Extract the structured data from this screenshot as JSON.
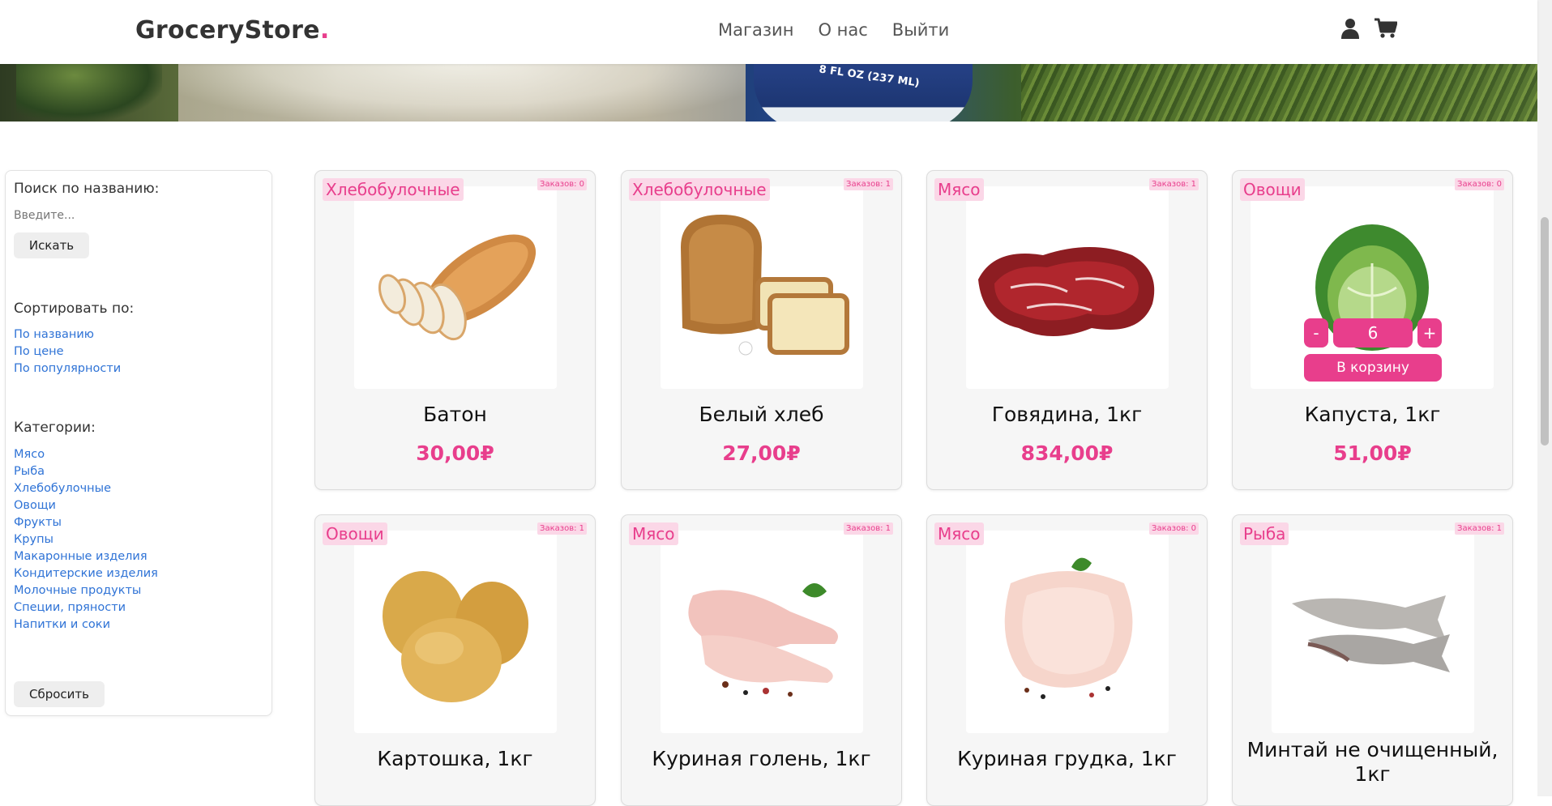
{
  "brand": {
    "name": "GroceryStore",
    "dot": ".",
    "accent": "#e83e8c"
  },
  "nav": {
    "links": [
      "Магазин",
      "О нас",
      "Выйти"
    ],
    "icons": [
      "user-icon",
      "shopping-cart-icon"
    ]
  },
  "hero": {
    "bottle_text": "8 FL OZ (237 ML)"
  },
  "sidebar": {
    "search_label": "Поиск по названию:",
    "search_placeholder": "Введите...",
    "search_button": "Искать",
    "sort_label": "Сортировать по:",
    "sort_options": [
      "По названию",
      "По цене",
      "По популярности"
    ],
    "categories_label": "Категории:",
    "categories": [
      "Мясо",
      "Рыба",
      "Хлебобулочные",
      "Овощи",
      "Фрукты",
      "Крупы",
      "Макаронные изделия",
      "Кондитерские изделия",
      "Молочные продукты",
      "Специи, пряности",
      "Напитки и соки"
    ],
    "reset_button": "Сбросить"
  },
  "products": [
    {
      "category": "Хлебобулочные",
      "orders": "Заказов: 0",
      "name": "Батон",
      "price": "30,00₽",
      "image": "baton"
    },
    {
      "category": "Хлебобулочные",
      "orders": "Заказов: 1",
      "name": "Белый хлеб",
      "price": "27,00₽",
      "image": "bread"
    },
    {
      "category": "Мясо",
      "orders": "Заказов: 1",
      "name": "Говядина, 1кг",
      "price": "834,00₽",
      "image": "beef"
    },
    {
      "category": "Овощи",
      "orders": "Заказов: 0",
      "name": "Капуста, 1кг",
      "price": "51,00₽",
      "image": "cabbage",
      "stepper": {
        "minus": "-",
        "value": "6",
        "plus": "+",
        "cart_button": "В корзину"
      }
    },
    {
      "category": "Овощи",
      "orders": "Заказов: 1",
      "name": "Картошка, 1кг",
      "price": "",
      "image": "potato"
    },
    {
      "category": "Мясо",
      "orders": "Заказов: 1",
      "name": "Куриная голень, 1кг",
      "price": "",
      "image": "drumstick"
    },
    {
      "category": "Мясо",
      "orders": "Заказов: 0",
      "name": "Куриная грудка, 1кг",
      "price": "",
      "image": "breast"
    },
    {
      "category": "Рыба",
      "orders": "Заказов: 1",
      "name": "Минтай не очищенный, 1кг",
      "price": "",
      "image": "fish"
    }
  ]
}
